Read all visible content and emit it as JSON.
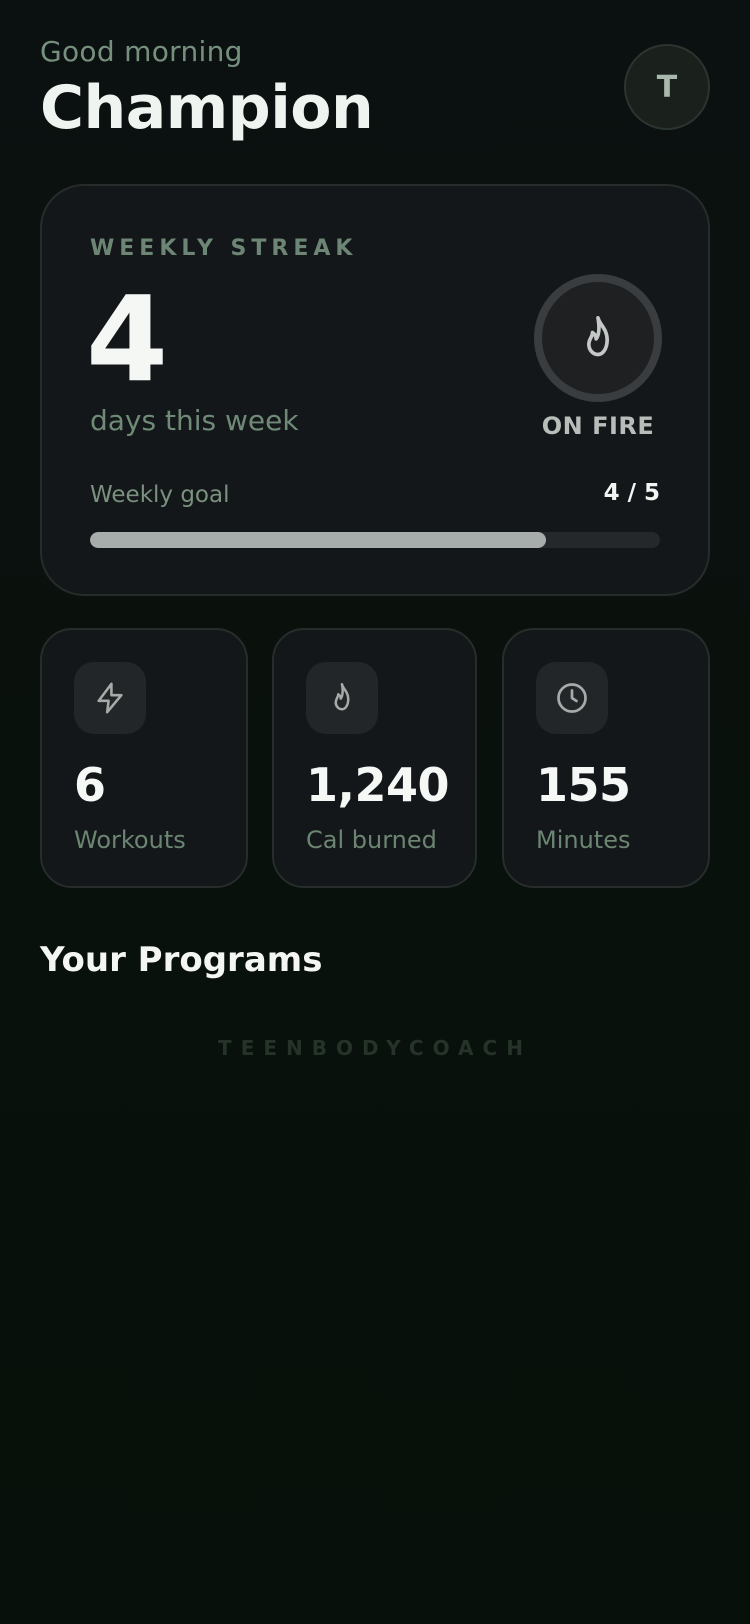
{
  "header": {
    "greeting": "Good morning",
    "name": "Champion",
    "avatar_initial": "T"
  },
  "streak": {
    "label": "WEEKLY STREAK",
    "days": "4",
    "subtitle": "days this week",
    "status": "ON FIRE",
    "status_icon": "flame-icon",
    "goal_label": "Weekly goal",
    "goal_value": "4 / 5",
    "goal_progress": 0.8
  },
  "stats": [
    {
      "icon": "lightning-icon",
      "value": "6",
      "label": "Workouts"
    },
    {
      "icon": "flame-icon",
      "value": "1,240",
      "label": "Cal burned"
    },
    {
      "icon": "clock-icon",
      "value": "155",
      "label": "Minutes"
    }
  ],
  "programs": {
    "title": "Your Programs"
  },
  "brand": "TEENBODYCOACH",
  "colors": {
    "background": "#0a110c",
    "card": "#141719",
    "muted_green": "#6f8a77",
    "progress_fill": "#a7adab"
  }
}
